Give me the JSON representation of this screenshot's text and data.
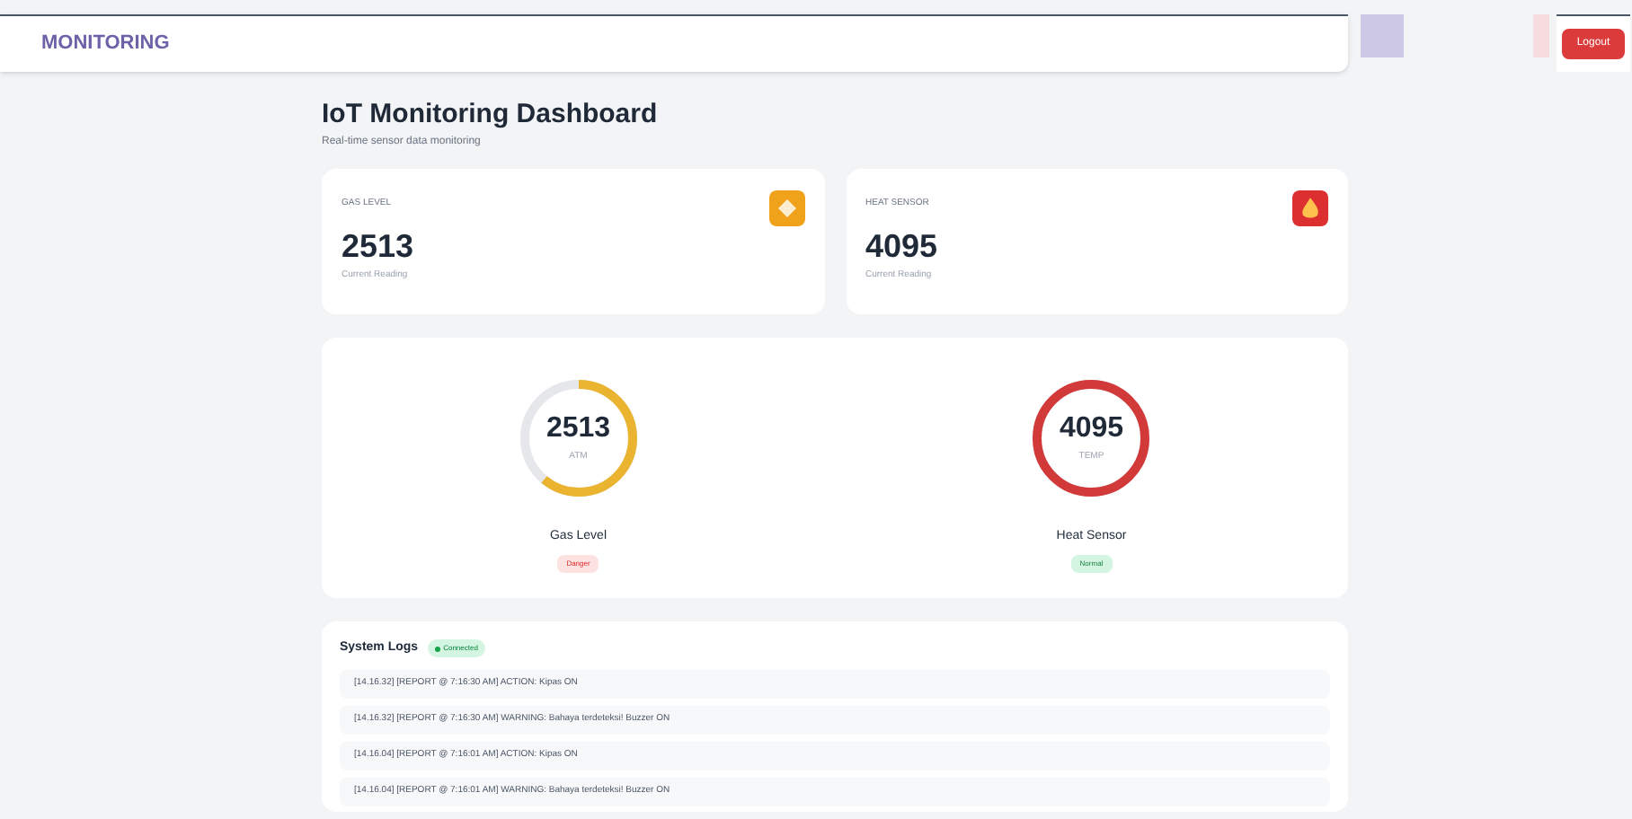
{
  "navbar": {
    "brand": "MONITORING",
    "logout": "Logout"
  },
  "header": {
    "title": "IoT Monitoring Dashboard",
    "subtitle": "Real-time sensor data monitoring"
  },
  "cards": [
    {
      "label": "GAS LEVEL",
      "value": "2513",
      "caption": "Current Reading",
      "color": "#f0a31a",
      "kind": "gas"
    },
    {
      "label": "HEAT SENSOR",
      "value": "4095",
      "caption": "Current Reading",
      "color": "#dc2f2f",
      "kind": "heat"
    }
  ],
  "gauges": [
    {
      "value": "2513",
      "unit": "ATM",
      "level": 0.61,
      "color": "#eab431",
      "name": "Gas Level",
      "status": "Danger",
      "kind": "danger"
    },
    {
      "value": "4095",
      "unit": "TEMP",
      "level": 1,
      "color": "#d23a3a",
      "name": "Heat Sensor",
      "status": "Normal",
      "kind": "normal"
    }
  ],
  "logs": {
    "title": "System Logs",
    "badge": "Connected",
    "entries": [
      "[14.16.32] [REPORT @ 7:16:30 AM] ACTION: Kipas ON",
      "[14.16.32] [REPORT @ 7:16:30 AM] WARNING: Bahaya terdeteksi! Buzzer ON",
      "[14.16.04] [REPORT @ 7:16:01 AM] ACTION: Kipas ON",
      "[14.16.04] [REPORT @ 7:16:01 AM] WARNING: Bahaya terdeteksi! Buzzer ON"
    ]
  }
}
